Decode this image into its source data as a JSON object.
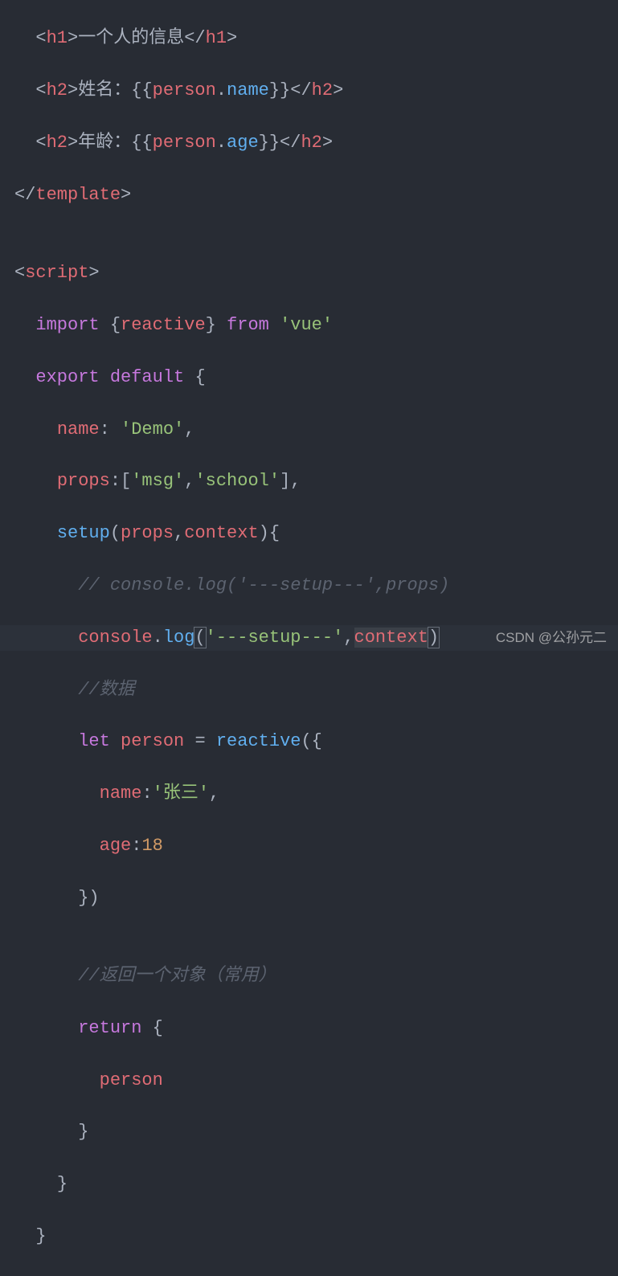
{
  "code": {
    "l01_pre": "  <",
    "l01_tag": "h1",
    "l01_text": ">一个人的信息</",
    "l01_tag2": "h1",
    "l01_end": ">",
    "l02_pre": "  <",
    "l02_tag": "h2",
    "l02_text": ">姓名：{{",
    "l02_var": "person",
    "l02_dot": ".",
    "l02_prop": "name",
    "l02_close": "}}</",
    "l02_tag2": "h2",
    "l02_end": ">",
    "l03_pre": "  <",
    "l03_tag": "h2",
    "l03_text": ">年龄：{{",
    "l03_var": "person",
    "l03_dot": ".",
    "l03_prop": "age",
    "l03_close": "}}</",
    "l03_tag2": "h2",
    "l03_end": ">",
    "l04_pre": "</",
    "l04_tag": "template",
    "l04_end": ">",
    "l05": "",
    "l06_pre": "<",
    "l06_tag": "script",
    "l06_end": ">",
    "l07_indent": "  ",
    "l07_import": "import",
    "l07_brace_o": " {",
    "l07_reactive": "reactive",
    "l07_brace_c": "}",
    "l07_from": " from ",
    "l07_from_kw": "from",
    "l07_vue": "'vue'",
    "l08_indent": "  ",
    "l08_export": "export",
    "l08_default": " default",
    "l08_brace": " {",
    "l09_indent": "    ",
    "l09_name": "name",
    "l09_colon": ": ",
    "l09_val": "'Demo'",
    "l09_comma": ",",
    "l10_indent": "    ",
    "l10_props": "props",
    "l10_colon": ":[",
    "l10_msg": "'msg'",
    "l10_comma1": ",",
    "l10_school": "'school'",
    "l10_end": "],",
    "l11_indent": "    ",
    "l11_setup": "setup",
    "l11_paren_o": "(",
    "l11_props": "props",
    "l11_comma": ",",
    "l11_context": "context",
    "l11_paren_c": "){",
    "l12_indent": "      ",
    "l12_comment": "// console.log('---setup---',props)",
    "l13_indent": "      ",
    "l13_console": "console",
    "l13_dot": ".",
    "l13_log": "log",
    "l13_paren_o": "(",
    "l13_str": "'---setup---'",
    "l13_comma": ",",
    "l13_context": "context",
    "l13_paren_c": ")",
    "l14_indent": "      ",
    "l14_comment": "//数据",
    "l15_indent": "      ",
    "l15_let": "let",
    "l15_person": " person",
    "l15_var": "person",
    "l15_eq": " = ",
    "l15_reactive": "reactive",
    "l15_paren": "({",
    "l16_indent": "        ",
    "l16_name": "name",
    "l16_colon": ":",
    "l16_val": "'张三'",
    "l16_comma": ",",
    "l17_indent": "        ",
    "l17_age": "age",
    "l17_colon": ":",
    "l17_val": "18",
    "l18_indent": "      ",
    "l18_close": "})",
    "l19": "",
    "l20_indent": "      ",
    "l20_comment": "//返回一个对象（常用）",
    "l21_indent": "      ",
    "l21_return": "return",
    "l21_brace": " {",
    "l22_indent": "        ",
    "l22_person": "person",
    "l23_indent": "      ",
    "l23_close": "}",
    "l24_indent": "    ",
    "l24_close": "}",
    "l25_indent": "  ",
    "l25_close": "}"
  },
  "watermark": "CSDN @公孙元二"
}
